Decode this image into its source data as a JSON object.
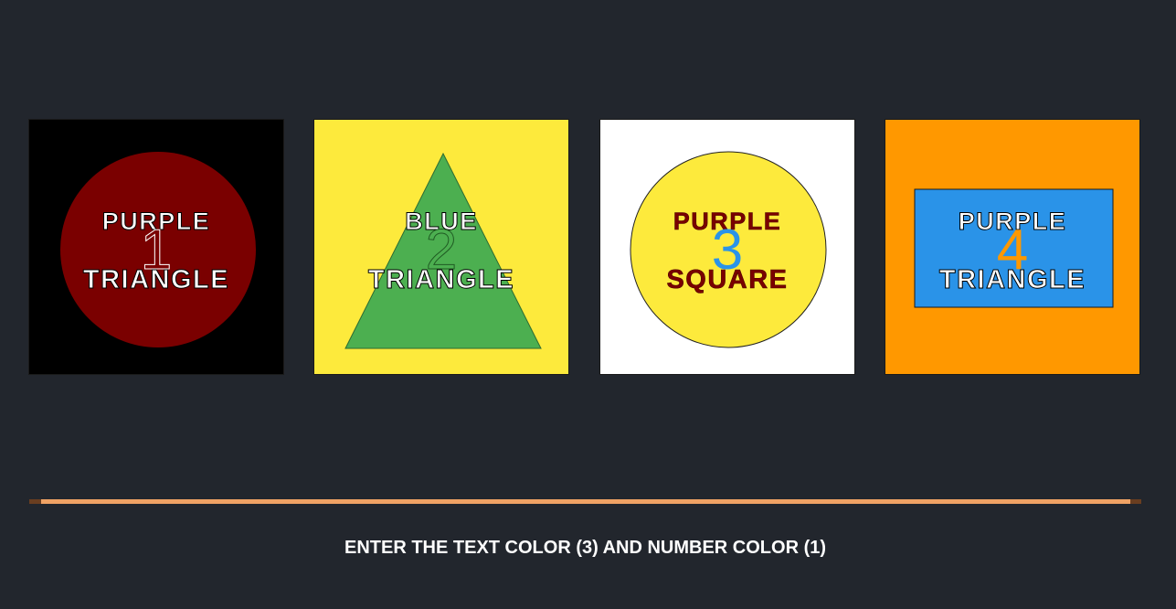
{
  "cards": [
    {
      "background": "#000000",
      "shape": "circle",
      "shape_color": "#7a0000",
      "top_word": "PURPLE",
      "bottom_word": "TRIANGLE",
      "number": "1",
      "number_color": "#7a0000",
      "number_stroke": "#ffffff"
    },
    {
      "background": "#fdea3c",
      "shape": "triangle",
      "shape_color": "#4caf50",
      "top_word": "BLUE",
      "bottom_word": "TRIANGLE",
      "number": "2",
      "number_color": "#4caf50",
      "number_stroke": "#1f5a22"
    },
    {
      "background": "#ffffff",
      "shape": "circle",
      "shape_color": "#fdea3c",
      "top_word": "PURPLE",
      "bottom_word": "SQUARE",
      "number": "3",
      "number_color": "#2a93e8",
      "number_stroke": "#2a93e8"
    },
    {
      "background": "#ff9800",
      "shape": "rectangle",
      "shape_color": "#2a93e8",
      "top_word": "PURPLE",
      "bottom_word": "TRIANGLE",
      "number": "4",
      "number_color": "#ff9800",
      "number_stroke": "#ff9800"
    }
  ],
  "progress": {
    "fraction_remaining": 0.99,
    "track_color": "#6a3e20",
    "fill_color": "#f0a264"
  },
  "instruction": "ENTER THE TEXT COLOR (3) AND NUMBER COLOR (1)"
}
